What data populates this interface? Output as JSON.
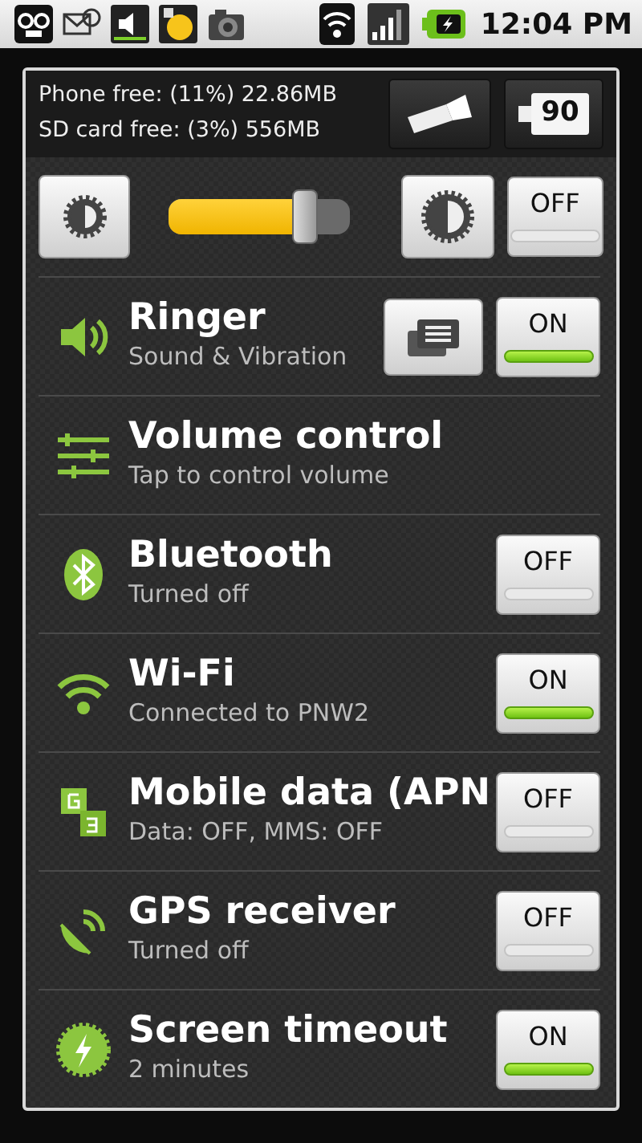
{
  "status_bar": {
    "time": "12:04 PM"
  },
  "header": {
    "storage_lines": [
      "Phone free: (11%) 22.86MB",
      "SD card free: (3%) 556MB"
    ],
    "battery": "90"
  },
  "brightness": {
    "level": 0.75,
    "toggle": {
      "label": "OFF",
      "on": false
    }
  },
  "rows": [
    {
      "title": "Ringer",
      "subtitle": "Sound & Vibration",
      "settings_button": true,
      "toggle": {
        "label": "ON",
        "on": true
      }
    },
    {
      "title": "Volume control",
      "subtitle": "Tap to control volume"
    },
    {
      "title": "Bluetooth",
      "subtitle": "Turned off",
      "toggle": {
        "label": "OFF",
        "on": false
      }
    },
    {
      "title": "Wi-Fi",
      "subtitle": "Connected to PNW2",
      "toggle": {
        "label": "ON",
        "on": true
      }
    },
    {
      "title": "Mobile data (APN",
      "subtitle": "Data: OFF, MMS: OFF",
      "toggle": {
        "label": "OFF",
        "on": false
      }
    },
    {
      "title": "GPS receiver",
      "subtitle": "Turned off",
      "toggle": {
        "label": "OFF",
        "on": false
      }
    },
    {
      "title": "Screen timeout",
      "subtitle": "2 minutes",
      "toggle": {
        "label": "ON",
        "on": true
      }
    }
  ]
}
